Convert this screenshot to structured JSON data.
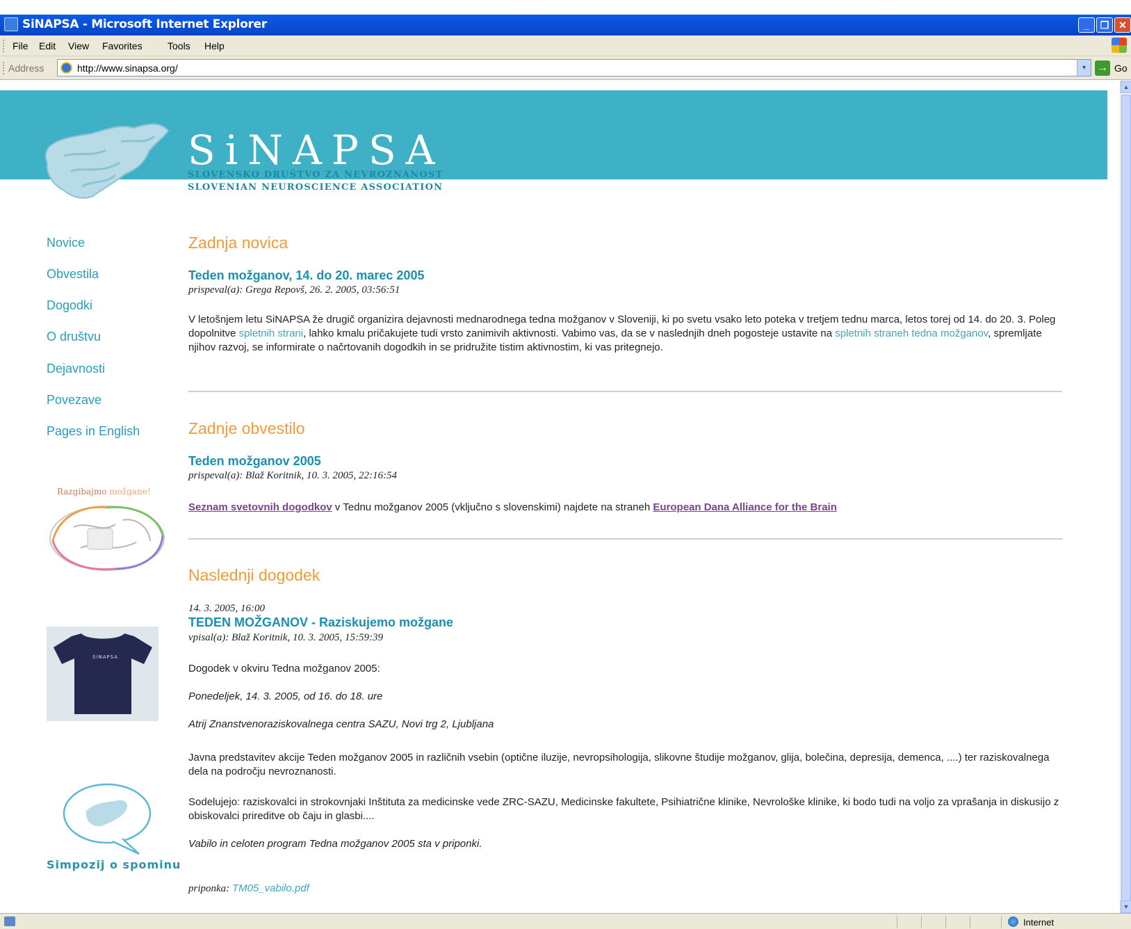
{
  "window": {
    "title": "SiNAPSA - Microsoft Internet Explorer",
    "controls": {
      "minimize": "_",
      "maximize": "❐",
      "close": "✕"
    }
  },
  "menu": [
    "File",
    "Edit",
    "View",
    "Favorites",
    "Tools",
    "Help"
  ],
  "address": {
    "label": "Address",
    "url": "http://www.sinapsa.org/",
    "go_label": "Go",
    "dropdown_glyph": "▾",
    "go_glyph": "→"
  },
  "site": {
    "name": "SiNAPSA",
    "subtitle_sl": "SLOVENSKO DRUŠTVO ZA NEVROZNANOST",
    "subtitle_en": "SLOVENIAN NEUROSCIENCE ASSOCIATION"
  },
  "nav": [
    "Novice",
    "Obvestila",
    "Dogodki",
    "O društvu",
    "Dejavnosti",
    "Povezave",
    "Pages in English"
  ],
  "sidebar": {
    "brain_caption_a": "Razgibajmo",
    "brain_caption_b": " možgane!",
    "tshirt_text": "SiNAPSA",
    "simpozij": "Simpozij o spominu"
  },
  "news": {
    "heading": "Zadnja novica",
    "title": "Teden možganov, 14. do 20. marec 2005",
    "meta": "prispeval(a): Grega Repovš, 26. 2. 2005, 03:56:51",
    "body_1": "V letošnjem letu SiNAPSA že drugič organizira dejavnosti mednarodnega tedna možganov v Sloveniji, ki po svetu vsako leto poteka v tretjem tednu marca, letos torej od 14. do 20. 3. Poleg dopolnitve ",
    "link_1": "spletnih strani",
    "body_2": ", lahko kmalu pričakujete tudi vrsto zanimivih aktivnosti. Vabimo vas, da se v naslednjih dneh pogosteje ustavite na ",
    "link_2": "spletnih straneh tedna možganov",
    "body_3": ", spremljate njihov razvoj, se informirate o načrtovanih dogodkih in se pridružite tistim aktivnostim, ki vas pritegnejo."
  },
  "notice": {
    "heading": "Zadnje obvestilo",
    "title": "Teden možganov 2005",
    "meta": "prispeval(a): Blaž Koritnik, 10. 3. 2005, 22:16:54",
    "link_1": "Seznam svetovnih dogodkov",
    "body": " v Tednu možganov 2005 (vključno s slovenskimi) najdete na straneh ",
    "link_2": "European Dana Alliance for the Brain"
  },
  "event": {
    "heading": "Naslednji dogodek",
    "datetime": "14. 3. 2005, 16:00",
    "title": "TEDEN MOŽGANOV - Raziskujemo možgane",
    "meta": "vpisal(a): Blaž Koritnik, 10. 3. 2005, 15:59:39",
    "p1": "Dogodek v okviru Tedna možganov 2005:",
    "p2": "Ponedeljek, 14. 3. 2005, od 16. do 18. ure",
    "p3": "Atrij Znanstvenoraziskovalnega centra SAZU, Novi trg 2, Ljubljana",
    "p4": "Javna predstavitev akcije Teden možganov 2005 in različnih vsebin (optične iluzije, nevropsihologija, slikovne študije možganov, glija, bolečina, depresija, demenca, ....) ter raziskovalnega dela na področju nevroznanosti.",
    "p5": "Sodelujejo: raziskovalci in strokovnjaki Inštituta za medicinske vede ZRC-SAZU, Medicinske fakultete, Psihiatrične klinike, Nevrološke klinike, ki bodo tudi na voljo za vprašanja in diskusijo z obiskovalci prireditve ob čaju in glasbi....",
    "p6": "Vabilo in celoten program Tedna možganov 2005 sta v priponki.",
    "attach_label": "priponka: ",
    "attach_file": "TM05_vabilo.pdf"
  },
  "status": {
    "zone": "Internet"
  }
}
